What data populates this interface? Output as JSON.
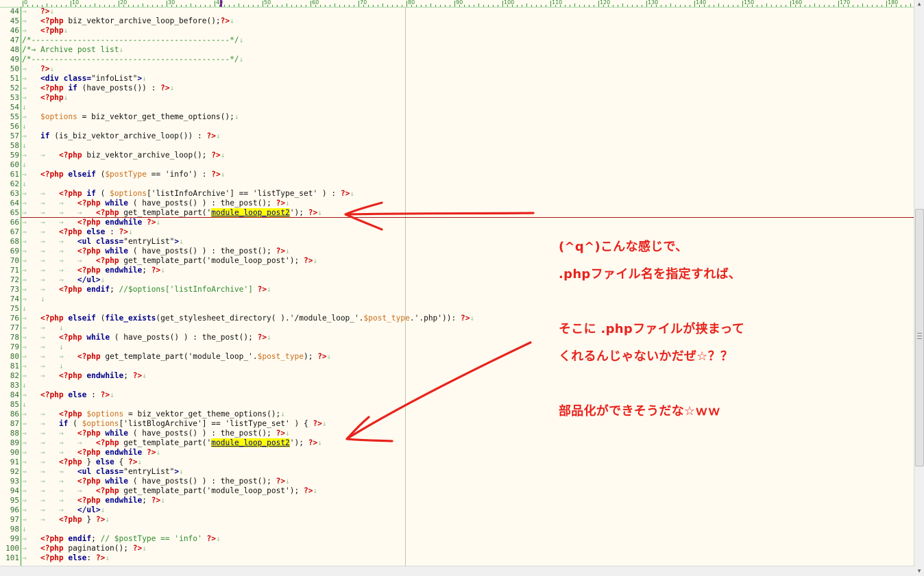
{
  "ruler": {
    "labels": [
      "0",
      "10",
      "20",
      "30",
      "40",
      "50",
      "60",
      "70",
      "80",
      "90",
      "100",
      "110",
      "120",
      "130",
      "140",
      "150",
      "160",
      "170",
      "180"
    ]
  },
  "editor": {
    "lines": [
      {
        "n": "44",
        "h": "→   <span class=\"red\">?&gt;</span><span class=\"mk\">↓</span>"
      },
      {
        "n": "45",
        "h": "→   <span class=\"red\">&lt;?php</span> biz_vektor_archive_loop_before();<span class=\"red\">?&gt;</span><span class=\"mk\">↓</span>"
      },
      {
        "n": "46",
        "h": "→   <span class=\"red\">&lt;?php</span><span class=\"mk\">↓</span>"
      },
      {
        "n": "47",
        "h": "<span class=\"cm\">/*-------------------------------------------*/</span><span class=\"mk\">↓</span>"
      },
      {
        "n": "48",
        "h": "<span class=\"cm\">/*→ Archive post list</span><span class=\"mk\">↓</span>"
      },
      {
        "n": "49",
        "h": "<span class=\"cm\">/*-------------------------------------------*/</span><span class=\"mk\">↓</span>"
      },
      {
        "n": "50",
        "h": "→   <span class=\"red\">?&gt;</span><span class=\"mk\">↓</span>"
      },
      {
        "n": "51",
        "h": "→   <span class=\"kw\">&lt;div class=</span>\"infoList\"<span class=\"kw\">&gt;</span><span class=\"mk\">↓</span>"
      },
      {
        "n": "52",
        "h": "→   <span class=\"red\">&lt;?php</span> <span class=\"kw\">if</span> (have_posts()) : <span class=\"red\">?&gt;</span><span class=\"mk\">↓</span>"
      },
      {
        "n": "53",
        "h": "→   <span class=\"red\">&lt;?php</span><span class=\"mk\">↓</span>"
      },
      {
        "n": "54",
        "h": "<span class=\"mk\">↓</span>"
      },
      {
        "n": "55",
        "h": "→   <span class=\"var\">$options</span> = biz_vektor_get_theme_options();<span class=\"mk\">↓</span>"
      },
      {
        "n": "56",
        "h": "<span class=\"mk\">↓</span>"
      },
      {
        "n": "57",
        "h": "→   <span class=\"kw\">if</span> (is_biz_vektor_archive_loop()) : <span class=\"red\">?&gt;</span><span class=\"mk\">↓</span>"
      },
      {
        "n": "58",
        "h": "<span class=\"mk\">↓</span>"
      },
      {
        "n": "59",
        "h": "→   →   <span class=\"red\">&lt;?php</span> biz_vektor_archive_loop(); <span class=\"red\">?&gt;</span><span class=\"mk\">↓</span>"
      },
      {
        "n": "60",
        "h": "<span class=\"mk\">↓</span>"
      },
      {
        "n": "61",
        "h": "→   <span class=\"red\">&lt;?php</span> <span class=\"kw\">elseif</span> (<span class=\"var\">$postType</span> == 'info') : <span class=\"red\">?&gt;</span><span class=\"mk\">↓</span>"
      },
      {
        "n": "62",
        "h": "<span class=\"mk\">↓</span>"
      },
      {
        "n": "63",
        "h": "→   →   <span class=\"red\">&lt;?php</span> <span class=\"kw\">if</span> ( <span class=\"var\">$options</span>['listInfoArchive'] == 'listType_set' ) : <span class=\"red\">?&gt;</span><span class=\"mk\">↓</span>"
      },
      {
        "n": "64",
        "h": "→   →   →   <span class=\"red\">&lt;?php</span> <span class=\"kw\">while</span> ( have_posts() ) : the_post(); <span class=\"red\">?&gt;</span><span class=\"mk\">↓</span>"
      },
      {
        "n": "65",
        "h": "→   →   →   →   <span class=\"red\">&lt;?php</span> get_template_part('<span class=\"hl\">module_loop_post2</span>'); <span class=\"red\">?&gt;</span><span class=\"mk\">↓</span>"
      },
      {
        "n": "66",
        "h": "→   →   →   <span class=\"red\">&lt;?php</span> <span class=\"kw\">endwhile</span> <span class=\"red\">?&gt;</span><span class=\"mk\">↓</span>"
      },
      {
        "n": "67",
        "h": "→   →   <span class=\"red\">&lt;?php</span> <span class=\"kw\">else</span> : <span class=\"red\">?&gt;</span><span class=\"mk\">↓</span>"
      },
      {
        "n": "68",
        "h": "→   →   →   <span class=\"kw\">&lt;ul class=</span>\"entryList\"<span class=\"kw\">&gt;</span><span class=\"mk\">↓</span>"
      },
      {
        "n": "69",
        "h": "→   →   →   <span class=\"red\">&lt;?php</span> <span class=\"kw\">while</span> ( have_posts() ) : the_post(); <span class=\"red\">?&gt;</span><span class=\"mk\">↓</span>"
      },
      {
        "n": "70",
        "h": "→   →   →   →   <span class=\"red\">&lt;?php</span> get_template_part('module_loop_post'); <span class=\"red\">?&gt;</span><span class=\"mk\">↓</span>"
      },
      {
        "n": "71",
        "h": "→   →   →   <span class=\"red\">&lt;?php</span> <span class=\"kw\">endwhile</span>; <span class=\"red\">?&gt;</span><span class=\"mk\">↓</span>"
      },
      {
        "n": "72",
        "h": "→   →   →   <span class=\"kw\">&lt;/ul&gt;</span><span class=\"mk\">↓</span>"
      },
      {
        "n": "73",
        "h": "→   →   <span class=\"red\">&lt;?php</span> <span class=\"kw\">endif</span>; <span class=\"cm\">//$options['listInfoArchive']</span> <span class=\"red\">?&gt;</span><span class=\"mk\">↓</span>"
      },
      {
        "n": "74",
        "h": "→   <span class=\"mk\">↓</span>"
      },
      {
        "n": "75",
        "h": "<span class=\"mk\">↓</span>"
      },
      {
        "n": "76",
        "h": "→   <span class=\"red\">&lt;?php</span> <span class=\"kw\">elseif</span> (<span class=\"kw\">file_exists</span>(get_stylesheet_directory( ).'/module_loop_'.<span class=\"var\">$post_type</span>.'.php')): <span class=\"red\">?&gt;</span><span class=\"mk\">↓</span>"
      },
      {
        "n": "77",
        "h": "→   →   <span class=\"mk\">↓</span>"
      },
      {
        "n": "78",
        "h": "→   →   <span class=\"red\">&lt;?php</span> <span class=\"kw\">while</span> ( have_posts() ) : the_post(); <span class=\"red\">?&gt;</span><span class=\"mk\">↓</span>"
      },
      {
        "n": "79",
        "h": "→   →   <span class=\"mk\">↓</span>"
      },
      {
        "n": "80",
        "h": "→   →   →   <span class=\"red\">&lt;?php</span> get_template_part('module_loop_'.<span class=\"var\">$post_type</span>); <span class=\"red\">?&gt;</span><span class=\"mk\">↓</span>"
      },
      {
        "n": "81",
        "h": "→   →   <span class=\"mk\">↓</span>"
      },
      {
        "n": "82",
        "h": "→   →   <span class=\"red\">&lt;?php</span> <span class=\"kw\">endwhile</span>; <span class=\"red\">?&gt;</span><span class=\"mk\">↓</span>"
      },
      {
        "n": "83",
        "h": "<span class=\"mk\">↓</span>"
      },
      {
        "n": "84",
        "h": "→   <span class=\"red\">&lt;?php</span> <span class=\"kw\">else</span> : <span class=\"red\">?&gt;</span><span class=\"mk\">↓</span>"
      },
      {
        "n": "85",
        "h": "<span class=\"mk\">↓</span>"
      },
      {
        "n": "86",
        "h": "→   →   <span class=\"red\">&lt;?php</span> <span class=\"var\">$options</span> = biz_vektor_get_theme_options();<span class=\"mk\">↓</span>"
      },
      {
        "n": "87",
        "h": "→   →   <span class=\"kw\">if</span> ( <span class=\"var\">$options</span>['listBlogArchive'] == 'listType_set' ) { <span class=\"red\">?&gt;</span><span class=\"mk\">↓</span>"
      },
      {
        "n": "88",
        "h": "→   →   →   <span class=\"red\">&lt;?php</span> <span class=\"kw\">while</span> ( have_posts() ) : the_post(); <span class=\"red\">?&gt;</span><span class=\"mk\">↓</span>"
      },
      {
        "n": "89",
        "h": "→   →   →   →   <span class=\"red\">&lt;?php</span> get_template_part('<span class=\"hl\">module_loop_post2</span>'); <span class=\"red\">?&gt;</span><span class=\"mk\">↓</span>"
      },
      {
        "n": "90",
        "h": "→   →   →   <span class=\"red\">&lt;?php</span> <span class=\"kw\">endwhile</span> <span class=\"red\">?&gt;</span><span class=\"mk\">↓</span>"
      },
      {
        "n": "91",
        "h": "→   →   <span class=\"red\">&lt;?php</span> } <span class=\"kw\">else</span> { <span class=\"red\">?&gt;</span><span class=\"mk\">↓</span>"
      },
      {
        "n": "92",
        "h": "→   →   →   <span class=\"kw\">&lt;ul class=</span>\"entryList\"<span class=\"kw\">&gt;</span><span class=\"mk\">↓</span>"
      },
      {
        "n": "93",
        "h": "→   →   →   <span class=\"red\">&lt;?php</span> <span class=\"kw\">while</span> ( have_posts() ) : the_post(); <span class=\"red\">?&gt;</span><span class=\"mk\">↓</span>"
      },
      {
        "n": "94",
        "h": "→   →   →   →   <span class=\"red\">&lt;?php</span> get_template_part('module_loop_post'); <span class=\"red\">?&gt;</span><span class=\"mk\">↓</span>"
      },
      {
        "n": "95",
        "h": "→   →   →   <span class=\"red\">&lt;?php</span> <span class=\"kw\">endwhile</span>; <span class=\"red\">?&gt;</span><span class=\"mk\">↓</span>"
      },
      {
        "n": "96",
        "h": "→   →   →   <span class=\"kw\">&lt;/ul&gt;</span><span class=\"mk\">↓</span>"
      },
      {
        "n": "97",
        "h": "→   →   <span class=\"red\">&lt;?php</span> } <span class=\"red\">?&gt;</span><span class=\"mk\">↓</span>"
      },
      {
        "n": "98",
        "h": "<span class=\"mk\">↓</span>"
      },
      {
        "n": "99",
        "h": "→   <span class=\"red\">&lt;?php</span> <span class=\"kw\">endif</span>; <span class=\"cm\">// $postType == 'info'</span> <span class=\"red\">?&gt;</span><span class=\"mk\">↓</span>"
      },
      {
        "n": "100",
        "h": "→   <span class=\"red\">&lt;?php</span> pagination(); <span class=\"red\">?&gt;</span><span class=\"mk\">↓</span>"
      },
      {
        "n": "101",
        "h": "→   <span class=\"red\">&lt;?php</span> <span class=\"kw\">else</span>: <span class=\"red\">?&gt;</span><span class=\"mk\">↓</span>"
      }
    ]
  },
  "annotations": {
    "line1": "(^q^)こんな感じで、",
    "line2": ".phpファイル名を指定すれば、",
    "line3": "そこに .phpファイルが挟まって",
    "line4": "くれるんじゃないかだぜ☆？？",
    "line5": "部品化ができそうだな☆ｗｗ",
    "color": "#e8231d"
  }
}
